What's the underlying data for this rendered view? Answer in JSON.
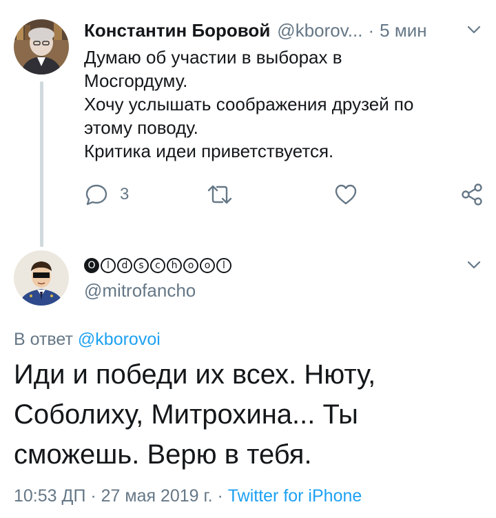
{
  "tweet1": {
    "display_name": "Константин Боровой",
    "handle": "@kborov...",
    "separator": "·",
    "time": "5 мин",
    "text_lines": [
      "Думаю об участии в выборах в",
      "Мосгордуму.",
      "Хочу услышать соображения друзей по",
      "этому поводу.",
      "Критика идеи приветствуется."
    ],
    "reply_count": "3"
  },
  "tweet2": {
    "display_name_letters": [
      "O",
      "l",
      "d",
      "s",
      "c",
      "h",
      "o",
      "o",
      "l"
    ],
    "handle": "@mitrofancho",
    "reply_prefix": "В ответ",
    "reply_mention": "@kborovoi",
    "text_lines": [
      "Иди и победи их всех. Нюту,",
      "Соболиху, Митрохина... Ты",
      "сможешь. Верю в тебя."
    ],
    "timestamp": "10:53 ДП · 27 мая 2019 г. ·",
    "source": "Twitter for iPhone"
  },
  "icons": {
    "reply": "reply-icon",
    "retweet": "retweet-icon",
    "like": "heart-icon",
    "share": "share-icon",
    "caret": "chevron-down-icon"
  },
  "colors": {
    "text": "#14171a",
    "secondary": "#657786",
    "link": "#1da1f2",
    "thread_line": "#cfd9de"
  }
}
